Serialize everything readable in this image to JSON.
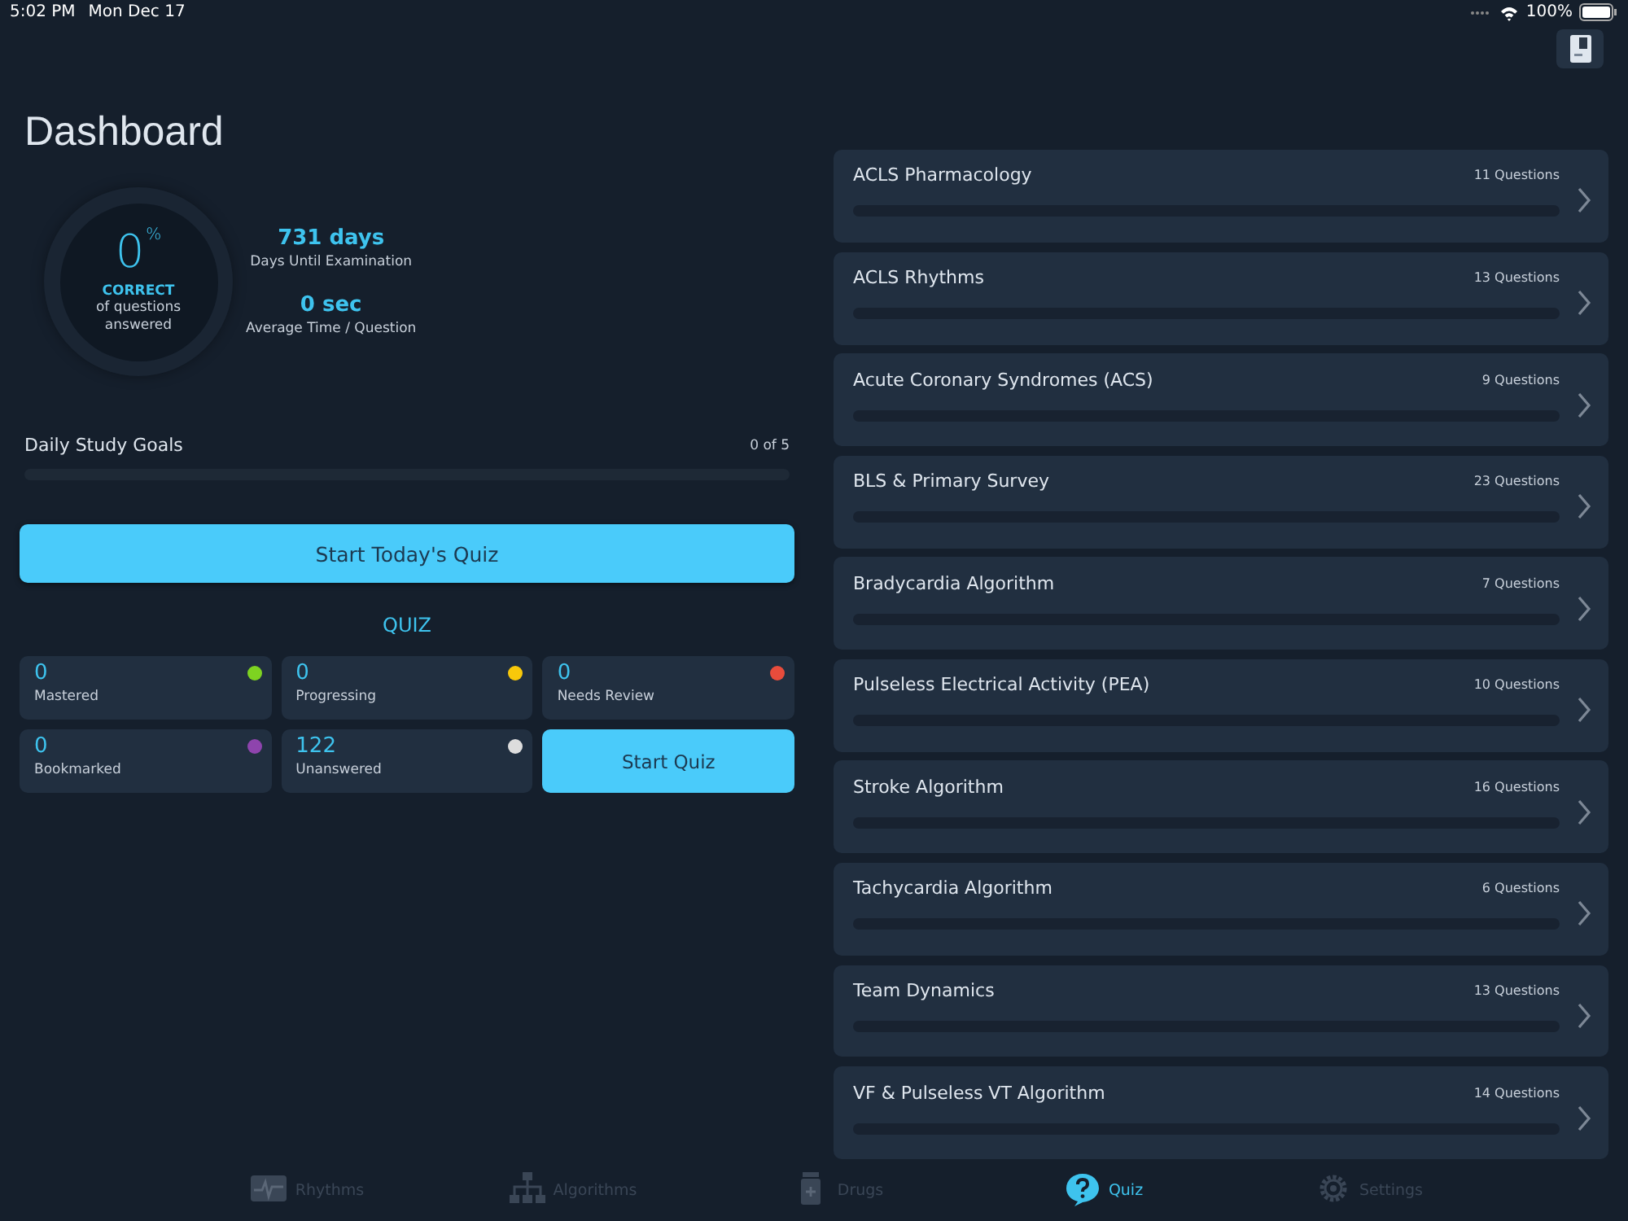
{
  "status_bar": {
    "time": "5:02 PM",
    "date": "Mon Dec 17",
    "battery": "100%"
  },
  "title": "Dashboard",
  "score": {
    "value": "0",
    "unit": "%",
    "label": "CORRECT",
    "caption": "of questions answered"
  },
  "stats": [
    {
      "value": "731 days",
      "label": "Days Until Examination"
    },
    {
      "value": "0 sec",
      "label": "Average Time / Question"
    }
  ],
  "daily_goals": {
    "label": "Daily Study Goals",
    "count": "0 of 5",
    "level": 0
  },
  "start_today_button": "Start Today's Quiz",
  "quiz": {
    "heading": "QUIZ",
    "tiles": [
      {
        "value": "0",
        "label": "Mastered",
        "color": "#7ed321"
      },
      {
        "value": "0",
        "label": "Progressing",
        "color": "#f8c80a"
      },
      {
        "value": "0",
        "label": "Needs Review",
        "color": "#e74c3c"
      },
      {
        "value": "0",
        "label": "Bookmarked",
        "color": "#8e44ad"
      },
      {
        "value": "122",
        "label": "Unanswered",
        "color": "#dddddd"
      }
    ],
    "start_button": "Start Quiz"
  },
  "topics": [
    {
      "name": "ACLS Pharmacology",
      "count": "11 Questions",
      "level": 0
    },
    {
      "name": "ACLS Rhythms",
      "count": "13 Questions",
      "level": 0
    },
    {
      "name": "Acute Coronary Syndromes (ACS)",
      "count": "9 Questions",
      "level": 0
    },
    {
      "name": "BLS & Primary Survey",
      "count": "23 Questions",
      "level": 0
    },
    {
      "name": "Bradycardia Algorithm",
      "count": "7 Questions",
      "level": 0
    },
    {
      "name": "Pulseless Electrical Activity (PEA)",
      "count": "10 Questions",
      "level": 0
    },
    {
      "name": "Stroke Algorithm",
      "count": "16 Questions",
      "level": 0
    },
    {
      "name": "Tachycardia Algorithm",
      "count": "6 Questions",
      "level": 0
    },
    {
      "name": "Team Dynamics",
      "count": "13 Questions",
      "level": 0
    },
    {
      "name": "VF & Pulseless VT Algorithm",
      "count": "14 Questions",
      "level": 0
    }
  ],
  "tab_bar": [
    {
      "label": "Rhythms",
      "kind": "rhythm",
      "selected": false
    },
    {
      "label": "Algorithms",
      "kind": "algorithm",
      "selected": false
    },
    {
      "label": "Drugs",
      "kind": "drug",
      "selected": false
    },
    {
      "label": "Quiz",
      "kind": "quiz",
      "selected": true
    },
    {
      "label": "Settings",
      "kind": "settings",
      "selected": false
    }
  ]
}
